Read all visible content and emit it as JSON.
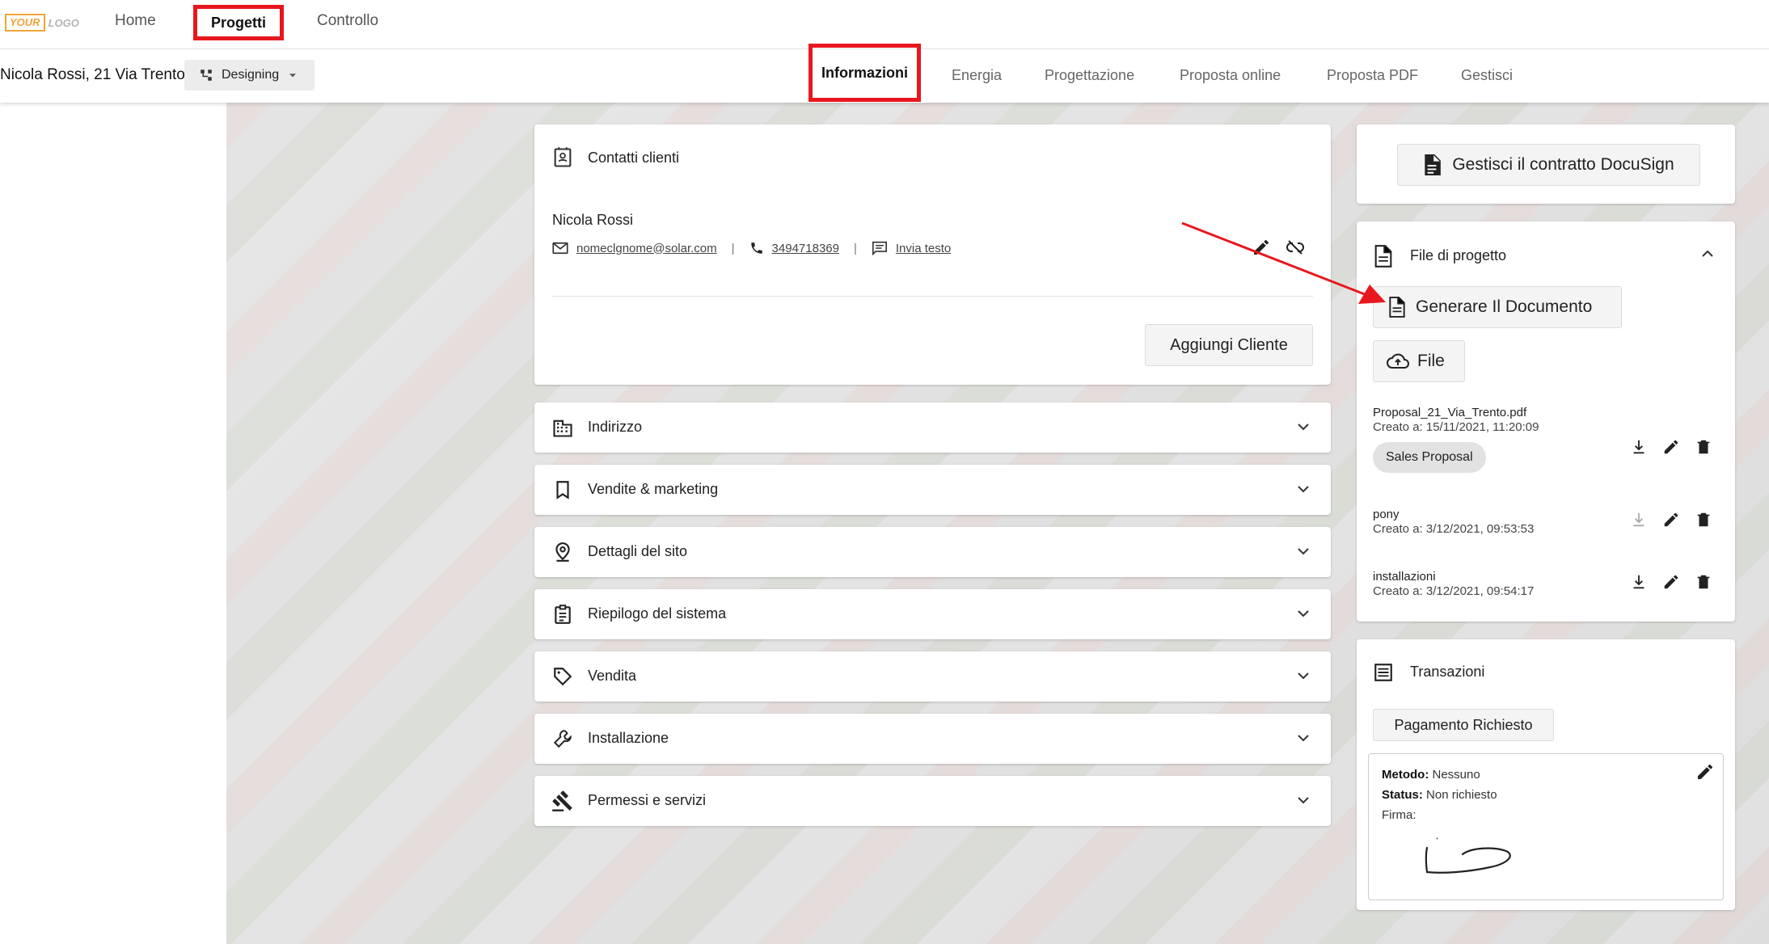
{
  "topnav": {
    "logo_your": "YOUR",
    "logo_text": "LOGO",
    "items": [
      {
        "label": "Home"
      },
      {
        "label": "Progetti"
      },
      {
        "label": "Controllo"
      }
    ]
  },
  "subheader": {
    "project_name": "Nicola Rossi, 21 Via Trento",
    "status_label": "Designing",
    "tabs": [
      {
        "label": "Informazioni"
      },
      {
        "label": "Energia"
      },
      {
        "label": "Progettazione"
      },
      {
        "label": "Proposta online"
      },
      {
        "label": "Proposta PDF"
      },
      {
        "label": "Gestisci"
      }
    ]
  },
  "contacts": {
    "title": "Contatti clienti",
    "client_name": "Nicola Rossi",
    "email": "nomeclgnome@solar.com",
    "phone": "3494718369",
    "send_text": "Invia testo",
    "add_client": "Aggiungi Cliente"
  },
  "accordions": [
    {
      "label": "Indirizzo",
      "icon": "building-icon"
    },
    {
      "label": "Vendite & marketing",
      "icon": "bookmark-icon"
    },
    {
      "label": "Dettagli del sito",
      "icon": "location-pin-icon"
    },
    {
      "label": "Riepilogo del sistema",
      "icon": "clipboard-icon"
    },
    {
      "label": "Vendita",
      "icon": "tag-icon"
    },
    {
      "label": "Installazione",
      "icon": "wrench-icon"
    },
    {
      "label": "Permessi e servizi",
      "icon": "gavel-icon"
    }
  ],
  "docusign": {
    "button_label": "Gestisci il contratto DocuSign"
  },
  "files": {
    "title": "File di progetto",
    "generate_label": "Generare Il Documento",
    "upload_label": "File",
    "items": [
      {
        "name": "Proposal_21_Via_Trento.pdf",
        "created": "Creato a: 15/11/2021, 11:20:09",
        "tag": "Sales Proposal"
      },
      {
        "name": "pony",
        "created": "Creato a: 3/12/2021, 09:53:53",
        "tag": ""
      },
      {
        "name": "installazioni",
        "created": "Creato a: 3/12/2021, 09:54:17",
        "tag": ""
      }
    ]
  },
  "transactions": {
    "title": "Transazioni",
    "payment_button": "Pagamento Richiesto",
    "method_label": "Metodo:",
    "method_value": "Nessuno",
    "status_label": "Status:",
    "status_value": "Non richiesto",
    "signature_label": "Firma:"
  },
  "colors": {
    "highlight": "#e8171e",
    "logo_accent": "#f2a33a"
  }
}
